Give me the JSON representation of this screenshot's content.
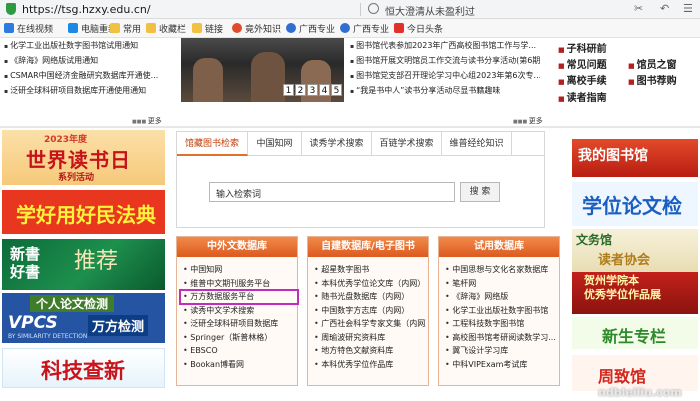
{
  "browser": {
    "url": "https://tsg.hzxy.edu.cn/",
    "search_hint": "恒大澄清从未盈利过",
    "bookmarks": [
      "在线视频",
      "电脑重装",
      "常用",
      "收藏栏",
      "链接",
      "竟外知识",
      "广西专业",
      "广西专业",
      "今日头条"
    ]
  },
  "top_left_news": [
    "化学工业出版社数字图书馆试用通知",
    "《辞海》网络版试用通知",
    "CSMAR中国经济金融研究数据库开通使...",
    "泛研全球科研项目数据库开通使用通知"
  ],
  "top_left_more": "更多",
  "slideshow_pager": [
    "1",
    "2",
    "3",
    "4",
    "5"
  ],
  "top_mid_news": [
    "图书馆代表参加2023年广西高校图书馆工作与学...",
    "图书馆开展文明馆员工作交流与读书分享活动(第6期)",
    "图书馆党支部召开理论学习中心组2023年第6次专...",
    "“我是书中人”读书分享活动尽显书籍趣味"
  ],
  "top_mid_more": "更多",
  "quick_links": [
    {
      "label": "子科研前"
    },
    {
      "label": "常见问题"
    },
    {
      "label": "馆员之窗"
    },
    {
      "label": "离校手续"
    },
    {
      "label": "图书荐购"
    },
    {
      "label": "读者指南"
    }
  ],
  "left_banners": {
    "reading_year": "2023年度",
    "reading_title": "世界读书日",
    "reading_sub": "系列活动",
    "law": "学好用好民法典",
    "new_books_1": "新書",
    "new_books_2": "好書",
    "new_books_deco": "推荐",
    "paper_check_title": "个人论文检测",
    "paper_check_vpcs": "VPCS",
    "paper_check_wanfang": "万方检测",
    "paper_check_tiny": "BY SIMILARITY DETECTION",
    "sci_search": "科技查新"
  },
  "search": {
    "tabs": [
      "馆藏图书检索",
      "中国知网",
      "读秀学术搜索",
      "百链学术搜索",
      "维普经纶知识"
    ],
    "placeholder": "输入检索词",
    "button": "搜 索"
  },
  "db_columns": [
    {
      "title": "中外文数据库",
      "items": [
        "中国知网",
        "维普中文期刊服务平台",
        "万方数据服务平台",
        "读秀中文学术搜索",
        "泛研全球科研项目数据库",
        "Springer（斯普林格）",
        "EBSCO",
        "Bookan博看网"
      ]
    },
    {
      "title": "自建数据库/电子图书",
      "items": [
        "超星数字图书",
        "本科优秀学位论文库（内网）",
        "随书光盘数据库（内网）",
        "中国数字方志库（内网）",
        "广西社会科学专家文集（内网）",
        "周瑜波研究资料库",
        "地方特色文献资料库",
        "本科优秀学位作品库"
      ]
    },
    {
      "title": "试用数据库",
      "items": [
        "中国思想与文化名家数据库",
        "笔杆网",
        "《辞海》网络版",
        "化学工业出版社数字图书馆",
        "工程科技数字图书馆",
        "高校图书馆考研阅读数学习...",
        "翼飞设计学习库",
        "中科VIPExam考试库"
      ]
    }
  ],
  "right_banners": {
    "my_library": "我的图书馆",
    "thesis": "学位论文检",
    "culture_1": "文务馆",
    "culture_2": "读者协会",
    "award_1": "贺州学院本",
    "award_2": "优秀学位作品展",
    "freshman": "新生专栏",
    "guide": "周致馆"
  },
  "watermark": "ndbleiliu.com"
}
